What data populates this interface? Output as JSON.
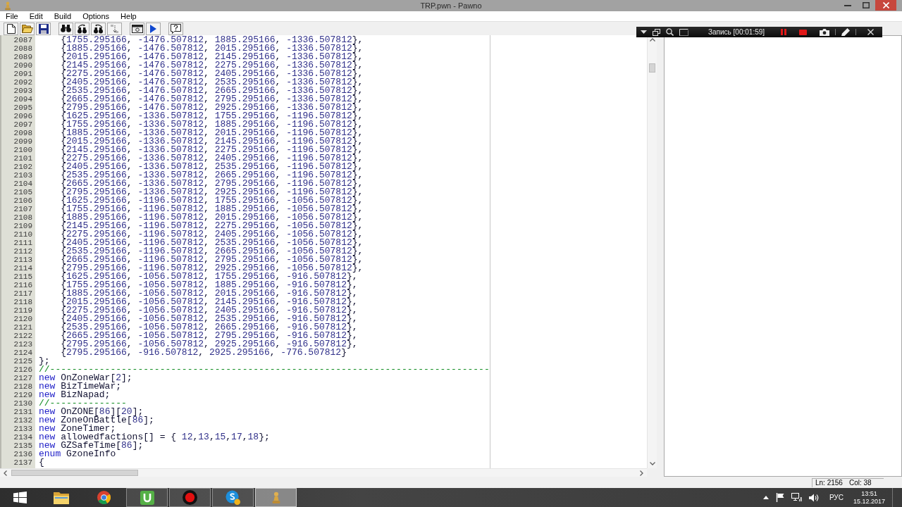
{
  "window": {
    "title": "TRP.pwn - Pawno"
  },
  "menu": [
    "File",
    "Edit",
    "Build",
    "Options",
    "Help"
  ],
  "recorder": {
    "status": "Запись [00:01:59]"
  },
  "editor": {
    "lines": [
      {
        "number": "2087",
        "code": [
          {
            "kind": "plain",
            "text": "    {"
          },
          {
            "kind": "number",
            "text": "1755.295166"
          },
          {
            "kind": "plain",
            "text": ", "
          },
          {
            "kind": "number",
            "text": "-1476.507812"
          },
          {
            "kind": "plain",
            "text": ", "
          },
          {
            "kind": "number",
            "text": "1885.295166"
          },
          {
            "kind": "plain",
            "text": ", "
          },
          {
            "kind": "number",
            "text": "-1336.507812"
          },
          {
            "kind": "plain",
            "text": "},"
          }
        ]
      },
      {
        "number": "2088",
        "code": [
          {
            "kind": "plain",
            "text": "    {"
          },
          {
            "kind": "number",
            "text": "1885.295166"
          },
          {
            "kind": "plain",
            "text": ", "
          },
          {
            "kind": "number",
            "text": "-1476.507812"
          },
          {
            "kind": "plain",
            "text": ", "
          },
          {
            "kind": "number",
            "text": "2015.295166"
          },
          {
            "kind": "plain",
            "text": ", "
          },
          {
            "kind": "number",
            "text": "-1336.507812"
          },
          {
            "kind": "plain",
            "text": "},"
          }
        ]
      },
      {
        "number": "2089",
        "code": [
          {
            "kind": "plain",
            "text": "    {"
          },
          {
            "kind": "number",
            "text": "2015.295166"
          },
          {
            "kind": "plain",
            "text": ", "
          },
          {
            "kind": "number",
            "text": "-1476.507812"
          },
          {
            "kind": "plain",
            "text": ", "
          },
          {
            "kind": "number",
            "text": "2145.295166"
          },
          {
            "kind": "plain",
            "text": ", "
          },
          {
            "kind": "number",
            "text": "-1336.507812"
          },
          {
            "kind": "plain",
            "text": "},"
          }
        ]
      },
      {
        "number": "2090",
        "code": [
          {
            "kind": "plain",
            "text": "    {"
          },
          {
            "kind": "number",
            "text": "2145.295166"
          },
          {
            "kind": "plain",
            "text": ", "
          },
          {
            "kind": "number",
            "text": "-1476.507812"
          },
          {
            "kind": "plain",
            "text": ", "
          },
          {
            "kind": "number",
            "text": "2275.295166"
          },
          {
            "kind": "plain",
            "text": ", "
          },
          {
            "kind": "number",
            "text": "-1336.507812"
          },
          {
            "kind": "plain",
            "text": "},"
          }
        ]
      },
      {
        "number": "2091",
        "code": [
          {
            "kind": "plain",
            "text": "    {"
          },
          {
            "kind": "number",
            "text": "2275.295166"
          },
          {
            "kind": "plain",
            "text": ", "
          },
          {
            "kind": "number",
            "text": "-1476.507812"
          },
          {
            "kind": "plain",
            "text": ", "
          },
          {
            "kind": "number",
            "text": "2405.295166"
          },
          {
            "kind": "plain",
            "text": ", "
          },
          {
            "kind": "number",
            "text": "-1336.507812"
          },
          {
            "kind": "plain",
            "text": "},"
          }
        ]
      },
      {
        "number": "2092",
        "code": [
          {
            "kind": "plain",
            "text": "    {"
          },
          {
            "kind": "number",
            "text": "2405.295166"
          },
          {
            "kind": "plain",
            "text": ", "
          },
          {
            "kind": "number",
            "text": "-1476.507812"
          },
          {
            "kind": "plain",
            "text": ", "
          },
          {
            "kind": "number",
            "text": "2535.295166"
          },
          {
            "kind": "plain",
            "text": ", "
          },
          {
            "kind": "number",
            "text": "-1336.507812"
          },
          {
            "kind": "plain",
            "text": "},"
          }
        ]
      },
      {
        "number": "2093",
        "code": [
          {
            "kind": "plain",
            "text": "    {"
          },
          {
            "kind": "number",
            "text": "2535.295166"
          },
          {
            "kind": "plain",
            "text": ", "
          },
          {
            "kind": "number",
            "text": "-1476.507812"
          },
          {
            "kind": "plain",
            "text": ", "
          },
          {
            "kind": "number",
            "text": "2665.295166"
          },
          {
            "kind": "plain",
            "text": ", "
          },
          {
            "kind": "number",
            "text": "-1336.507812"
          },
          {
            "kind": "plain",
            "text": "},"
          }
        ]
      },
      {
        "number": "2094",
        "code": [
          {
            "kind": "plain",
            "text": "    {"
          },
          {
            "kind": "number",
            "text": "2665.295166"
          },
          {
            "kind": "plain",
            "text": ", "
          },
          {
            "kind": "number",
            "text": "-1476.507812"
          },
          {
            "kind": "plain",
            "text": ", "
          },
          {
            "kind": "number",
            "text": "2795.295166"
          },
          {
            "kind": "plain",
            "text": ", "
          },
          {
            "kind": "number",
            "text": "-1336.507812"
          },
          {
            "kind": "plain",
            "text": "},"
          }
        ]
      },
      {
        "number": "2095",
        "code": [
          {
            "kind": "plain",
            "text": "    {"
          },
          {
            "kind": "number",
            "text": "2795.295166"
          },
          {
            "kind": "plain",
            "text": ", "
          },
          {
            "kind": "number",
            "text": "-1476.507812"
          },
          {
            "kind": "plain",
            "text": ", "
          },
          {
            "kind": "number",
            "text": "2925.295166"
          },
          {
            "kind": "plain",
            "text": ", "
          },
          {
            "kind": "number",
            "text": "-1336.507812"
          },
          {
            "kind": "plain",
            "text": "},"
          }
        ]
      },
      {
        "number": "2096",
        "code": [
          {
            "kind": "plain",
            "text": "    {"
          },
          {
            "kind": "number",
            "text": "1625.295166"
          },
          {
            "kind": "plain",
            "text": ", "
          },
          {
            "kind": "number",
            "text": "-1336.507812"
          },
          {
            "kind": "plain",
            "text": ", "
          },
          {
            "kind": "number",
            "text": "1755.295166"
          },
          {
            "kind": "plain",
            "text": ", "
          },
          {
            "kind": "number",
            "text": "-1196.507812"
          },
          {
            "kind": "plain",
            "text": "},"
          }
        ]
      },
      {
        "number": "2097",
        "code": [
          {
            "kind": "plain",
            "text": "    {"
          },
          {
            "kind": "number",
            "text": "1755.295166"
          },
          {
            "kind": "plain",
            "text": ", "
          },
          {
            "kind": "number",
            "text": "-1336.507812"
          },
          {
            "kind": "plain",
            "text": ", "
          },
          {
            "kind": "number",
            "text": "1885.295166"
          },
          {
            "kind": "plain",
            "text": ", "
          },
          {
            "kind": "number",
            "text": "-1196.507812"
          },
          {
            "kind": "plain",
            "text": "},"
          }
        ]
      },
      {
        "number": "2098",
        "code": [
          {
            "kind": "plain",
            "text": "    {"
          },
          {
            "kind": "number",
            "text": "1885.295166"
          },
          {
            "kind": "plain",
            "text": ", "
          },
          {
            "kind": "number",
            "text": "-1336.507812"
          },
          {
            "kind": "plain",
            "text": ", "
          },
          {
            "kind": "number",
            "text": "2015.295166"
          },
          {
            "kind": "plain",
            "text": ", "
          },
          {
            "kind": "number",
            "text": "-1196.507812"
          },
          {
            "kind": "plain",
            "text": "},"
          }
        ]
      },
      {
        "number": "2099",
        "code": [
          {
            "kind": "plain",
            "text": "    {"
          },
          {
            "kind": "number",
            "text": "2015.295166"
          },
          {
            "kind": "plain",
            "text": ", "
          },
          {
            "kind": "number",
            "text": "-1336.507812"
          },
          {
            "kind": "plain",
            "text": ", "
          },
          {
            "kind": "number",
            "text": "2145.295166"
          },
          {
            "kind": "plain",
            "text": ", "
          },
          {
            "kind": "number",
            "text": "-1196.507812"
          },
          {
            "kind": "plain",
            "text": "},"
          }
        ]
      },
      {
        "number": "2100",
        "code": [
          {
            "kind": "plain",
            "text": "    {"
          },
          {
            "kind": "number",
            "text": "2145.295166"
          },
          {
            "kind": "plain",
            "text": ", "
          },
          {
            "kind": "number",
            "text": "-1336.507812"
          },
          {
            "kind": "plain",
            "text": ", "
          },
          {
            "kind": "number",
            "text": "2275.295166"
          },
          {
            "kind": "plain",
            "text": ", "
          },
          {
            "kind": "number",
            "text": "-1196.507812"
          },
          {
            "kind": "plain",
            "text": "},"
          }
        ]
      },
      {
        "number": "2101",
        "code": [
          {
            "kind": "plain",
            "text": "    {"
          },
          {
            "kind": "number",
            "text": "2275.295166"
          },
          {
            "kind": "plain",
            "text": ", "
          },
          {
            "kind": "number",
            "text": "-1336.507812"
          },
          {
            "kind": "plain",
            "text": ", "
          },
          {
            "kind": "number",
            "text": "2405.295166"
          },
          {
            "kind": "plain",
            "text": ", "
          },
          {
            "kind": "number",
            "text": "-1196.507812"
          },
          {
            "kind": "plain",
            "text": "},"
          }
        ]
      },
      {
        "number": "2102",
        "code": [
          {
            "kind": "plain",
            "text": "    {"
          },
          {
            "kind": "number",
            "text": "2405.295166"
          },
          {
            "kind": "plain",
            "text": ", "
          },
          {
            "kind": "number",
            "text": "-1336.507812"
          },
          {
            "kind": "plain",
            "text": ", "
          },
          {
            "kind": "number",
            "text": "2535.295166"
          },
          {
            "kind": "plain",
            "text": ", "
          },
          {
            "kind": "number",
            "text": "-1196.507812"
          },
          {
            "kind": "plain",
            "text": "},"
          }
        ]
      },
      {
        "number": "2103",
        "code": [
          {
            "kind": "plain",
            "text": "    {"
          },
          {
            "kind": "number",
            "text": "2535.295166"
          },
          {
            "kind": "plain",
            "text": ", "
          },
          {
            "kind": "number",
            "text": "-1336.507812"
          },
          {
            "kind": "plain",
            "text": ", "
          },
          {
            "kind": "number",
            "text": "2665.295166"
          },
          {
            "kind": "plain",
            "text": ", "
          },
          {
            "kind": "number",
            "text": "-1196.507812"
          },
          {
            "kind": "plain",
            "text": "},"
          }
        ]
      },
      {
        "number": "2104",
        "code": [
          {
            "kind": "plain",
            "text": "    {"
          },
          {
            "kind": "number",
            "text": "2665.295166"
          },
          {
            "kind": "plain",
            "text": ", "
          },
          {
            "kind": "number",
            "text": "-1336.507812"
          },
          {
            "kind": "plain",
            "text": ", "
          },
          {
            "kind": "number",
            "text": "2795.295166"
          },
          {
            "kind": "plain",
            "text": ", "
          },
          {
            "kind": "number",
            "text": "-1196.507812"
          },
          {
            "kind": "plain",
            "text": "},"
          }
        ]
      },
      {
        "number": "2105",
        "code": [
          {
            "kind": "plain",
            "text": "    {"
          },
          {
            "kind": "number",
            "text": "2795.295166"
          },
          {
            "kind": "plain",
            "text": ", "
          },
          {
            "kind": "number",
            "text": "-1336.507812"
          },
          {
            "kind": "plain",
            "text": ", "
          },
          {
            "kind": "number",
            "text": "2925.295166"
          },
          {
            "kind": "plain",
            "text": ", "
          },
          {
            "kind": "number",
            "text": "-1196.507812"
          },
          {
            "kind": "plain",
            "text": "},"
          }
        ]
      },
      {
        "number": "2106",
        "code": [
          {
            "kind": "plain",
            "text": "    {"
          },
          {
            "kind": "number",
            "text": "1625.295166"
          },
          {
            "kind": "plain",
            "text": ", "
          },
          {
            "kind": "number",
            "text": "-1196.507812"
          },
          {
            "kind": "plain",
            "text": ", "
          },
          {
            "kind": "number",
            "text": "1755.295166"
          },
          {
            "kind": "plain",
            "text": ", "
          },
          {
            "kind": "number",
            "text": "-1056.507812"
          },
          {
            "kind": "plain",
            "text": "},"
          }
        ]
      },
      {
        "number": "2107",
        "code": [
          {
            "kind": "plain",
            "text": "    {"
          },
          {
            "kind": "number",
            "text": "1755.295166"
          },
          {
            "kind": "plain",
            "text": ", "
          },
          {
            "kind": "number",
            "text": "-1196.507812"
          },
          {
            "kind": "plain",
            "text": ", "
          },
          {
            "kind": "number",
            "text": "1885.295166"
          },
          {
            "kind": "plain",
            "text": ", "
          },
          {
            "kind": "number",
            "text": "-1056.507812"
          },
          {
            "kind": "plain",
            "text": "},"
          }
        ]
      },
      {
        "number": "2108",
        "code": [
          {
            "kind": "plain",
            "text": "    {"
          },
          {
            "kind": "number",
            "text": "1885.295166"
          },
          {
            "kind": "plain",
            "text": ", "
          },
          {
            "kind": "number",
            "text": "-1196.507812"
          },
          {
            "kind": "plain",
            "text": ", "
          },
          {
            "kind": "number",
            "text": "2015.295166"
          },
          {
            "kind": "plain",
            "text": ", "
          },
          {
            "kind": "number",
            "text": "-1056.507812"
          },
          {
            "kind": "plain",
            "text": "},"
          }
        ]
      },
      {
        "number": "2109",
        "code": [
          {
            "kind": "plain",
            "text": "    {"
          },
          {
            "kind": "number",
            "text": "2145.295166"
          },
          {
            "kind": "plain",
            "text": ", "
          },
          {
            "kind": "number",
            "text": "-1196.507812"
          },
          {
            "kind": "plain",
            "text": ", "
          },
          {
            "kind": "number",
            "text": "2275.295166"
          },
          {
            "kind": "plain",
            "text": ", "
          },
          {
            "kind": "number",
            "text": "-1056.507812"
          },
          {
            "kind": "plain",
            "text": "},"
          }
        ]
      },
      {
        "number": "2110",
        "code": [
          {
            "kind": "plain",
            "text": "    {"
          },
          {
            "kind": "number",
            "text": "2275.295166"
          },
          {
            "kind": "plain",
            "text": ", "
          },
          {
            "kind": "number",
            "text": "-1196.507812"
          },
          {
            "kind": "plain",
            "text": ", "
          },
          {
            "kind": "number",
            "text": "2405.295166"
          },
          {
            "kind": "plain",
            "text": ", "
          },
          {
            "kind": "number",
            "text": "-1056.507812"
          },
          {
            "kind": "plain",
            "text": "},"
          }
        ]
      },
      {
        "number": "2111",
        "code": [
          {
            "kind": "plain",
            "text": "    {"
          },
          {
            "kind": "number",
            "text": "2405.295166"
          },
          {
            "kind": "plain",
            "text": ", "
          },
          {
            "kind": "number",
            "text": "-1196.507812"
          },
          {
            "kind": "plain",
            "text": ", "
          },
          {
            "kind": "number",
            "text": "2535.295166"
          },
          {
            "kind": "plain",
            "text": ", "
          },
          {
            "kind": "number",
            "text": "-1056.507812"
          },
          {
            "kind": "plain",
            "text": "},"
          }
        ]
      },
      {
        "number": "2112",
        "code": [
          {
            "kind": "plain",
            "text": "    {"
          },
          {
            "kind": "number",
            "text": "2535.295166"
          },
          {
            "kind": "plain",
            "text": ", "
          },
          {
            "kind": "number",
            "text": "-1196.507812"
          },
          {
            "kind": "plain",
            "text": ", "
          },
          {
            "kind": "number",
            "text": "2665.295166"
          },
          {
            "kind": "plain",
            "text": ", "
          },
          {
            "kind": "number",
            "text": "-1056.507812"
          },
          {
            "kind": "plain",
            "text": "},"
          }
        ]
      },
      {
        "number": "2113",
        "code": [
          {
            "kind": "plain",
            "text": "    {"
          },
          {
            "kind": "number",
            "text": "2665.295166"
          },
          {
            "kind": "plain",
            "text": ", "
          },
          {
            "kind": "number",
            "text": "-1196.507812"
          },
          {
            "kind": "plain",
            "text": ", "
          },
          {
            "kind": "number",
            "text": "2795.295166"
          },
          {
            "kind": "plain",
            "text": ", "
          },
          {
            "kind": "number",
            "text": "-1056.507812"
          },
          {
            "kind": "plain",
            "text": "},"
          }
        ]
      },
      {
        "number": "2114",
        "code": [
          {
            "kind": "plain",
            "text": "    {"
          },
          {
            "kind": "number",
            "text": "2795.295166"
          },
          {
            "kind": "plain",
            "text": ", "
          },
          {
            "kind": "number",
            "text": "-1196.507812"
          },
          {
            "kind": "plain",
            "text": ", "
          },
          {
            "kind": "number",
            "text": "2925.295166"
          },
          {
            "kind": "plain",
            "text": ", "
          },
          {
            "kind": "number",
            "text": "-1056.507812"
          },
          {
            "kind": "plain",
            "text": "},"
          }
        ]
      },
      {
        "number": "2115",
        "code": [
          {
            "kind": "plain",
            "text": "    {"
          },
          {
            "kind": "number",
            "text": "1625.295166"
          },
          {
            "kind": "plain",
            "text": ", "
          },
          {
            "kind": "number",
            "text": "-1056.507812"
          },
          {
            "kind": "plain",
            "text": ", "
          },
          {
            "kind": "number",
            "text": "1755.295166"
          },
          {
            "kind": "plain",
            "text": ", "
          },
          {
            "kind": "number",
            "text": "-916.507812"
          },
          {
            "kind": "plain",
            "text": "},"
          }
        ]
      },
      {
        "number": "2116",
        "code": [
          {
            "kind": "plain",
            "text": "    {"
          },
          {
            "kind": "number",
            "text": "1755.295166"
          },
          {
            "kind": "plain",
            "text": ", "
          },
          {
            "kind": "number",
            "text": "-1056.507812"
          },
          {
            "kind": "plain",
            "text": ", "
          },
          {
            "kind": "number",
            "text": "1885.295166"
          },
          {
            "kind": "plain",
            "text": ", "
          },
          {
            "kind": "number",
            "text": "-916.507812"
          },
          {
            "kind": "plain",
            "text": "},"
          }
        ]
      },
      {
        "number": "2117",
        "code": [
          {
            "kind": "plain",
            "text": "    {"
          },
          {
            "kind": "number",
            "text": "1885.295166"
          },
          {
            "kind": "plain",
            "text": ", "
          },
          {
            "kind": "number",
            "text": "-1056.507812"
          },
          {
            "kind": "plain",
            "text": ", "
          },
          {
            "kind": "number",
            "text": "2015.295166"
          },
          {
            "kind": "plain",
            "text": ", "
          },
          {
            "kind": "number",
            "text": "-916.507812"
          },
          {
            "kind": "plain",
            "text": "},"
          }
        ]
      },
      {
        "number": "2118",
        "code": [
          {
            "kind": "plain",
            "text": "    {"
          },
          {
            "kind": "number",
            "text": "2015.295166"
          },
          {
            "kind": "plain",
            "text": ", "
          },
          {
            "kind": "number",
            "text": "-1056.507812"
          },
          {
            "kind": "plain",
            "text": ", "
          },
          {
            "kind": "number",
            "text": "2145.295166"
          },
          {
            "kind": "plain",
            "text": ", "
          },
          {
            "kind": "number",
            "text": "-916.507812"
          },
          {
            "kind": "plain",
            "text": "},"
          }
        ]
      },
      {
        "number": "2119",
        "code": [
          {
            "kind": "plain",
            "text": "    {"
          },
          {
            "kind": "number",
            "text": "2275.295166"
          },
          {
            "kind": "plain",
            "text": ", "
          },
          {
            "kind": "number",
            "text": "-1056.507812"
          },
          {
            "kind": "plain",
            "text": ", "
          },
          {
            "kind": "number",
            "text": "2405.295166"
          },
          {
            "kind": "plain",
            "text": ", "
          },
          {
            "kind": "number",
            "text": "-916.507812"
          },
          {
            "kind": "plain",
            "text": "},"
          }
        ]
      },
      {
        "number": "2120",
        "code": [
          {
            "kind": "plain",
            "text": "    {"
          },
          {
            "kind": "number",
            "text": "2405.295166"
          },
          {
            "kind": "plain",
            "text": ", "
          },
          {
            "kind": "number",
            "text": "-1056.507812"
          },
          {
            "kind": "plain",
            "text": ", "
          },
          {
            "kind": "number",
            "text": "2535.295166"
          },
          {
            "kind": "plain",
            "text": ", "
          },
          {
            "kind": "number",
            "text": "-916.507812"
          },
          {
            "kind": "plain",
            "text": "},"
          }
        ]
      },
      {
        "number": "2121",
        "code": [
          {
            "kind": "plain",
            "text": "    {"
          },
          {
            "kind": "number",
            "text": "2535.295166"
          },
          {
            "kind": "plain",
            "text": ", "
          },
          {
            "kind": "number",
            "text": "-1056.507812"
          },
          {
            "kind": "plain",
            "text": ", "
          },
          {
            "kind": "number",
            "text": "2665.295166"
          },
          {
            "kind": "plain",
            "text": ", "
          },
          {
            "kind": "number",
            "text": "-916.507812"
          },
          {
            "kind": "plain",
            "text": "},"
          }
        ]
      },
      {
        "number": "2122",
        "code": [
          {
            "kind": "plain",
            "text": "    {"
          },
          {
            "kind": "number",
            "text": "2665.295166"
          },
          {
            "kind": "plain",
            "text": ", "
          },
          {
            "kind": "number",
            "text": "-1056.507812"
          },
          {
            "kind": "plain",
            "text": ", "
          },
          {
            "kind": "number",
            "text": "2795.295166"
          },
          {
            "kind": "plain",
            "text": ", "
          },
          {
            "kind": "number",
            "text": "-916.507812"
          },
          {
            "kind": "plain",
            "text": "},"
          }
        ]
      },
      {
        "number": "2123",
        "code": [
          {
            "kind": "plain",
            "text": "    {"
          },
          {
            "kind": "number",
            "text": "2795.295166"
          },
          {
            "kind": "plain",
            "text": ", "
          },
          {
            "kind": "number",
            "text": "-1056.507812"
          },
          {
            "kind": "plain",
            "text": ", "
          },
          {
            "kind": "number",
            "text": "2925.295166"
          },
          {
            "kind": "plain",
            "text": ", "
          },
          {
            "kind": "number",
            "text": "-916.507812"
          },
          {
            "kind": "plain",
            "text": "},"
          }
        ]
      },
      {
        "number": "2124",
        "code": [
          {
            "kind": "plain",
            "text": "    {"
          },
          {
            "kind": "number",
            "text": "2795.295166"
          },
          {
            "kind": "plain",
            "text": ", "
          },
          {
            "kind": "number",
            "text": "-916.507812"
          },
          {
            "kind": "plain",
            "text": ", "
          },
          {
            "kind": "number",
            "text": "2925.295166"
          },
          {
            "kind": "plain",
            "text": ", "
          },
          {
            "kind": "number",
            "text": "-776.507812"
          },
          {
            "kind": "plain",
            "text": "}"
          }
        ]
      },
      {
        "number": "2125",
        "code": [
          {
            "kind": "plain",
            "text": "};"
          }
        ]
      },
      {
        "number": "2126",
        "code": [
          {
            "kind": "comment",
            "text": "//--------------------------------------------------------------------------------"
          }
        ]
      },
      {
        "number": "2127",
        "code": [
          {
            "kind": "keyword",
            "text": "new"
          },
          {
            "kind": "plain",
            "text": " OnZoneWar["
          },
          {
            "kind": "number",
            "text": "2"
          },
          {
            "kind": "plain",
            "text": "];"
          }
        ]
      },
      {
        "number": "2128",
        "code": [
          {
            "kind": "keyword",
            "text": "new"
          },
          {
            "kind": "plain",
            "text": " BizTimeWar;"
          }
        ]
      },
      {
        "number": "2129",
        "code": [
          {
            "kind": "keyword",
            "text": "new"
          },
          {
            "kind": "plain",
            "text": " BizNapad;"
          }
        ]
      },
      {
        "number": "2130",
        "code": [
          {
            "kind": "comment",
            "text": "//--------------"
          }
        ]
      },
      {
        "number": "2131",
        "code": [
          {
            "kind": "keyword",
            "text": "new"
          },
          {
            "kind": "plain",
            "text": " OnZONE["
          },
          {
            "kind": "number",
            "text": "86"
          },
          {
            "kind": "plain",
            "text": "]["
          },
          {
            "kind": "number",
            "text": "20"
          },
          {
            "kind": "plain",
            "text": "];"
          }
        ]
      },
      {
        "number": "2132",
        "code": [
          {
            "kind": "keyword",
            "text": "new"
          },
          {
            "kind": "plain",
            "text": " ZoneOnBattle["
          },
          {
            "kind": "number",
            "text": "86"
          },
          {
            "kind": "plain",
            "text": "];"
          }
        ]
      },
      {
        "number": "2133",
        "code": [
          {
            "kind": "keyword",
            "text": "new"
          },
          {
            "kind": "plain",
            "text": " ZoneTimer;"
          }
        ]
      },
      {
        "number": "2134",
        "code": [
          {
            "kind": "keyword",
            "text": "new"
          },
          {
            "kind": "plain",
            "text": " allowedfactions[] = { "
          },
          {
            "kind": "number",
            "text": "12"
          },
          {
            "kind": "plain",
            "text": ","
          },
          {
            "kind": "number",
            "text": "13"
          },
          {
            "kind": "plain",
            "text": ","
          },
          {
            "kind": "number",
            "text": "15"
          },
          {
            "kind": "plain",
            "text": ","
          },
          {
            "kind": "number",
            "text": "17"
          },
          {
            "kind": "plain",
            "text": ","
          },
          {
            "kind": "number",
            "text": "18"
          },
          {
            "kind": "plain",
            "text": "};"
          }
        ]
      },
      {
        "number": "2135",
        "code": [
          {
            "kind": "keyword",
            "text": "new"
          },
          {
            "kind": "plain",
            "text": " GZSafeTime["
          },
          {
            "kind": "number",
            "text": "86"
          },
          {
            "kind": "plain",
            "text": "];"
          }
        ]
      },
      {
        "number": "2136",
        "code": [
          {
            "kind": "keyword",
            "text": "enum"
          },
          {
            "kind": "plain",
            "text": " GzoneInfo"
          }
        ]
      },
      {
        "number": "2137",
        "code": [
          {
            "kind": "plain",
            "text": "{"
          }
        ]
      }
    ]
  },
  "status_bar": {
    "line": "Ln: 2156",
    "column": "Col: 38"
  },
  "taskbar": {
    "apps": [
      {
        "running": false,
        "selected": false
      },
      {
        "running": false,
        "selected": false
      },
      {
        "running": true,
        "selected": false
      },
      {
        "running": true,
        "selected": false
      },
      {
        "running": true,
        "selected": false
      },
      {
        "running": true,
        "selected": true
      }
    ],
    "language": "РУС",
    "time": "13:51",
    "date": "15.12.2017"
  }
}
